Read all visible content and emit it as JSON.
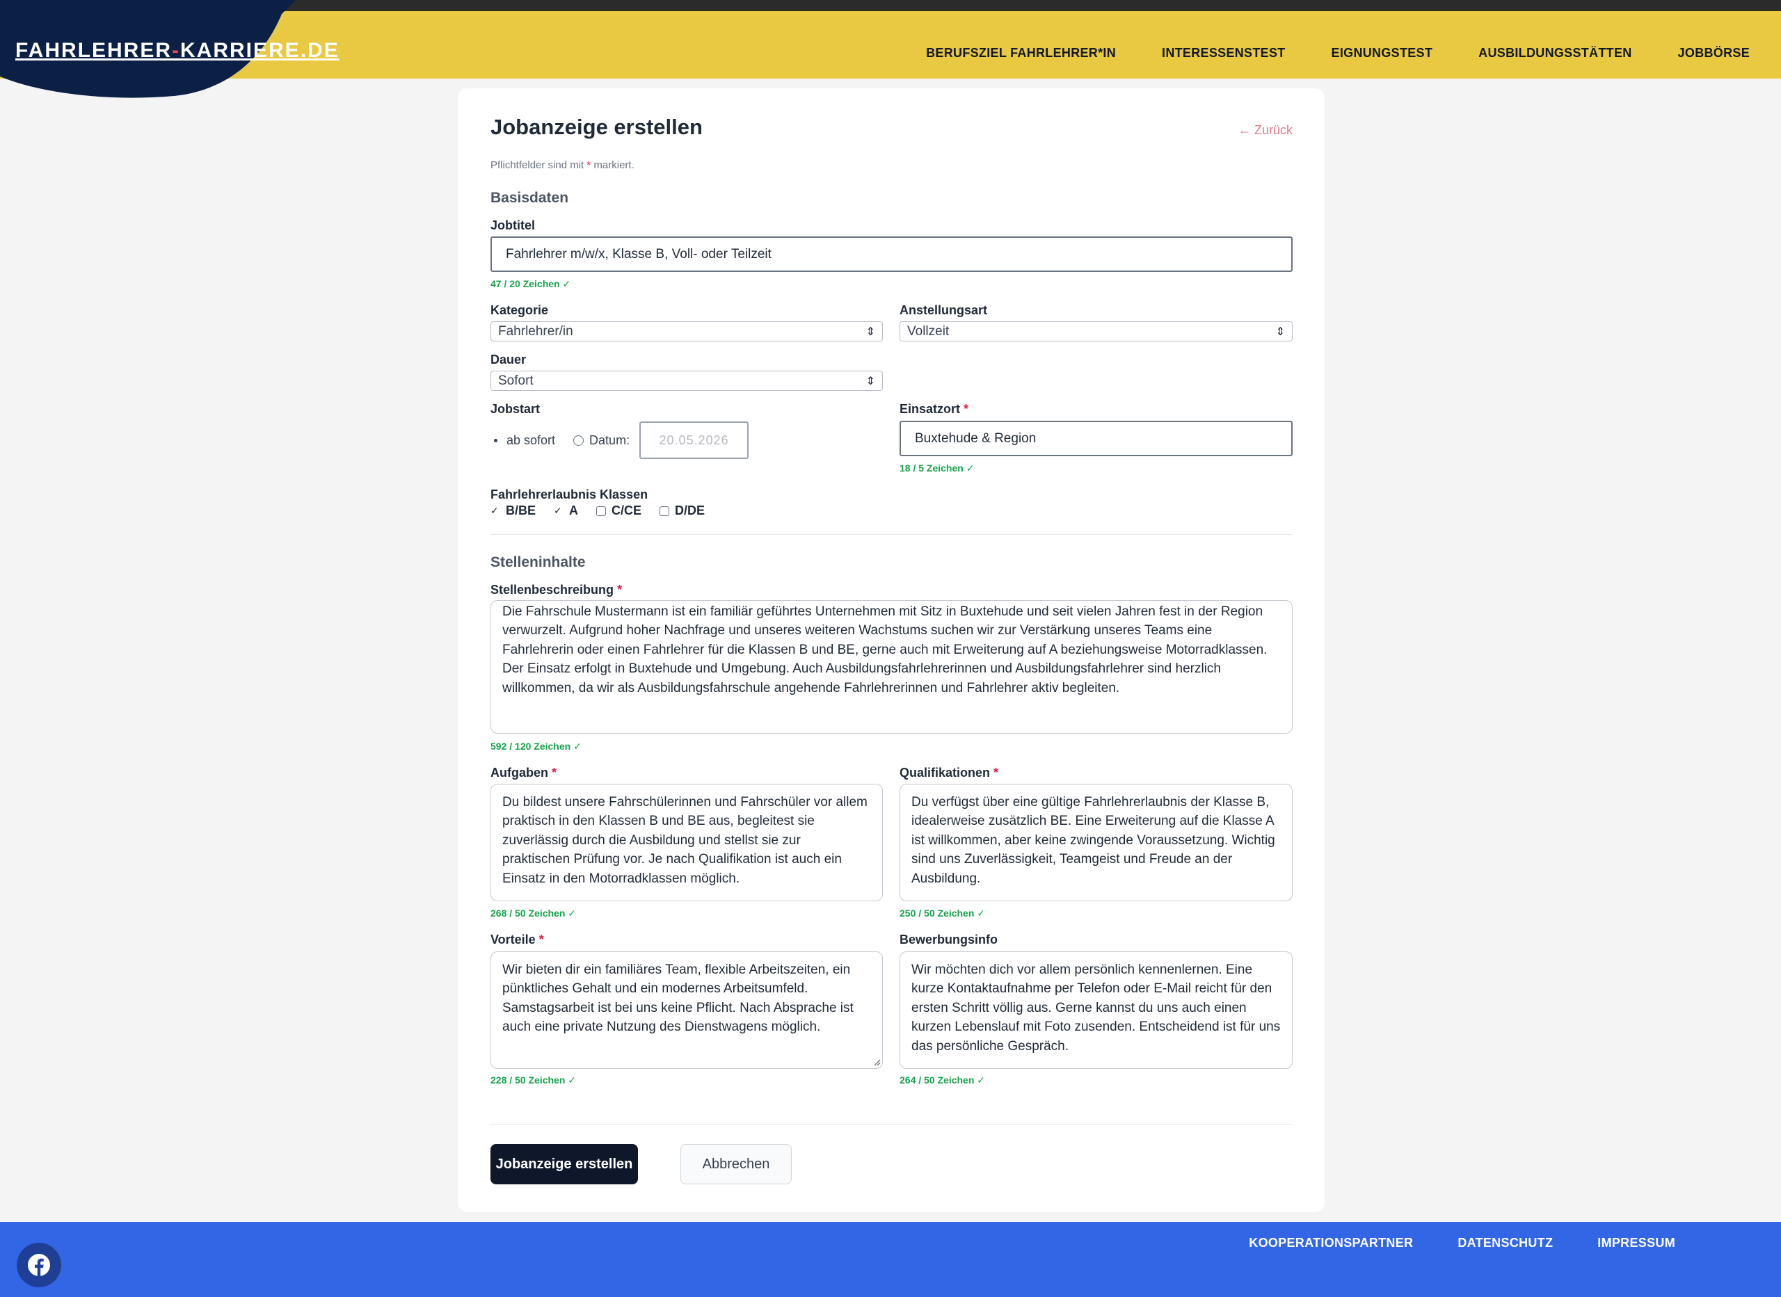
{
  "header": {
    "logo_main": "FAHRLEHRER",
    "logo_sep": "-",
    "logo_end": "KARRIERE.DE",
    "nav": [
      "BERUFSZIEL FAHRLEHRER*IN",
      "INTERESSENSTEST",
      "EIGNUNGSTEST",
      "AUSBILDUNGSSTÄTTEN",
      "JOBBÖRSE"
    ]
  },
  "form": {
    "title": "Jobanzeige erstellen",
    "back_link": "← Zurück",
    "required_note_prefix": "Pflichtfelder sind mit",
    "required_note_star": "*",
    "required_note_suffix": "markiert.",
    "section_basics": "Basisdaten",
    "jobtitel": {
      "label": "Jobtitel",
      "value": "Fahrlehrer m/w/x, Klasse B, Voll- oder Teilzeit",
      "count": "47 / 20 Zeichen ✓"
    },
    "kategorie": {
      "label": "Kategorie",
      "value": "Fahrlehrer/in"
    },
    "anstellungsart": {
      "label": "Anstellungsart",
      "value": "Vollzeit"
    },
    "dauer": {
      "label": "Dauer",
      "value": "Sofort"
    },
    "jobstart": {
      "label": "Jobstart",
      "option_immediate": "ab sofort",
      "option_date": "Datum:",
      "date_value": "20.05.2026",
      "selected": "ab sofort"
    },
    "einsatzort": {
      "label": "Einsatzort",
      "star": "*",
      "value": "Buxtehude & Region",
      "count": "18 / 5 Zeichen ✓"
    },
    "licenses": {
      "label": "Fahrlehrerlaubnis Klassen",
      "items": [
        {
          "label": "B/BE",
          "checked": true
        },
        {
          "label": "A",
          "checked": true
        },
        {
          "label": "C/CE",
          "checked": false
        },
        {
          "label": "D/DE",
          "checked": false
        }
      ]
    },
    "section_content": "Stelleninhalte",
    "stellenbeschreibung": {
      "label": "Stellenbeschreibung",
      "star": "*",
      "value": "Die Fahrschule Mustermann ist ein familiär geführtes Unternehmen mit Sitz in Buxtehude und seit vielen Jahren fest in der Region verwurzelt. Aufgrund hoher Nachfrage und unseres weiteren Wachstums suchen wir zur Verstärkung unseres Teams eine Fahrlehrerin oder einen Fahrlehrer für die Klassen B und BE, gerne auch mit Erweiterung auf A beziehungsweise Motorradklassen. Der Einsatz erfolgt in Buxtehude und Umgebung. Auch Ausbildungsfahrlehrerinnen und Ausbildungsfahrlehrer sind herzlich willkommen, da wir als Ausbildungsfahrschule angehende Fahrlehrerinnen und Fahrlehrer aktiv begleiten.",
      "count": "592 / 120 Zeichen ✓"
    },
    "aufgaben": {
      "label": "Aufgaben",
      "star": "*",
      "value": "Du bildest unsere Fahrschülerinnen und Fahrschüler vor allem praktisch in den Klassen B und BE aus, begleitest sie zuverlässig durch die Ausbildung und stellst sie zur praktischen Prüfung vor. Je nach Qualifikation ist auch ein Einsatz in den Motorradklassen möglich.",
      "count": "268 / 50 Zeichen ✓"
    },
    "qualifikationen": {
      "label": "Qualifikationen",
      "star": "*",
      "value": "Du verfügst über eine gültige Fahrlehrerlaubnis der Klasse B, idealerweise zusätzlich BE. Eine Erweiterung auf die Klasse A ist willkommen, aber keine zwingende Voraussetzung. Wichtig sind uns Zuverlässigkeit, Teamgeist und Freude an der Ausbildung.",
      "count": "250 / 50 Zeichen ✓"
    },
    "vorteile": {
      "label": "Vorteile",
      "star": "*",
      "value": "Wir bieten dir ein familiäres Team, flexible Arbeitszeiten, ein pünktliches Gehalt und ein modernes Arbeitsumfeld. Samstagsarbeit ist bei uns keine Pflicht. Nach Absprache ist auch eine private Nutzung des Dienstwagens möglich.",
      "count": "228 / 50 Zeichen ✓"
    },
    "bewerbungsinfo": {
      "label": "Bewerbungsinfo",
      "value": "Wir möchten dich vor allem persönlich kennenlernen. Eine kurze Kontaktaufnahme per Telefon oder E-Mail reicht für den ersten Schritt völlig aus. Gerne kannst du uns auch einen kurzen Lebenslauf mit Foto zusenden. Entscheidend ist für uns das persönliche Gespräch.",
      "count": "264 / 50 Zeichen ✓"
    },
    "submit_label": "Jobanzeige erstellen",
    "cancel_label": "Abbrechen"
  },
  "footer": {
    "social_icon": "facebook-icon",
    "links": [
      "KOOPERATIONSPARTNER",
      "DATENSCHUTZ",
      "IMPRESSUM"
    ]
  },
  "colors": {
    "header_bg": "#e9c842",
    "logo_bg": "#0c1f44",
    "footer_bg": "#3366e4",
    "primary_button": "#0f172a",
    "success_green": "#16a34a",
    "required_red": "#e11d48"
  }
}
